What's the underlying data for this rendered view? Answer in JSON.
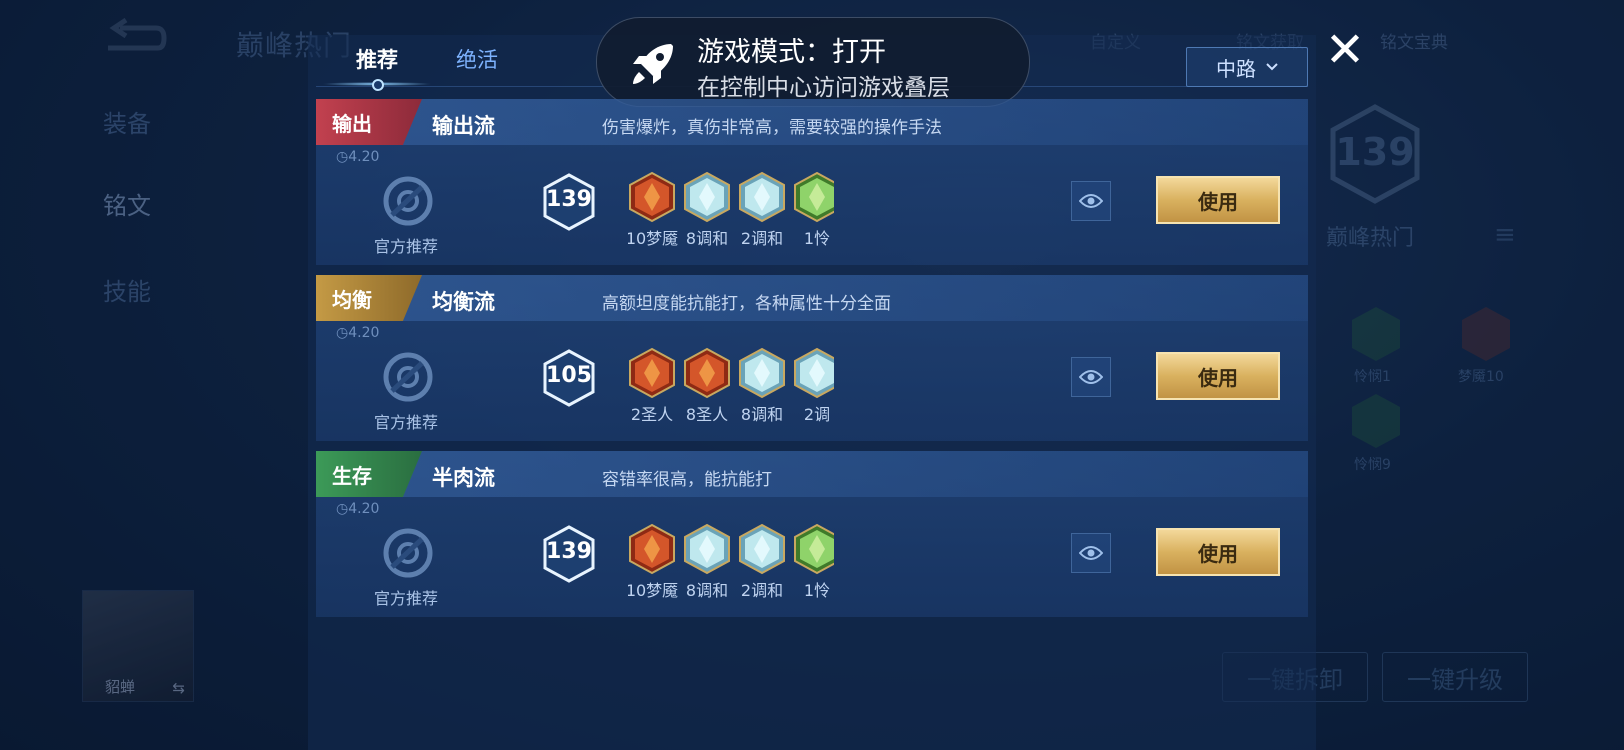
{
  "background": {
    "title": "巅峰热门",
    "sidebar": [
      "装备",
      "铭文",
      "技能"
    ],
    "top_links": [
      "自定义",
      "铭文获取",
      "铭文宝典"
    ],
    "hero_name": "貂蝉",
    "hot_level": "139",
    "hot_label": "巅峰热门",
    "gem_labels": [
      "怜悯1",
      "梦魇10",
      "怜悯9"
    ],
    "buttons": [
      "一键拆卸",
      "一键升级"
    ]
  },
  "banner": {
    "title": "游戏模式：打开",
    "subtitle": "在控制中心访问游戏叠层",
    "icon": "rocket-icon"
  },
  "tabs": [
    {
      "label": "推荐",
      "active": true
    },
    {
      "label": "绝活",
      "active": false
    }
  ],
  "lane_select": {
    "value": "中路"
  },
  "cards": [
    {
      "tag": "输出",
      "tag_color": "#c2414f",
      "name": "输出流",
      "desc": "伤害爆炸，真伤非常高，需要较强的操作手法",
      "date": "4.20",
      "official": "官方推荐",
      "level": "139",
      "gems": [
        {
          "label": "10梦魇",
          "color": "red"
        },
        {
          "label": "8调和",
          "color": "blue"
        },
        {
          "label": "2调和",
          "color": "blue"
        },
        {
          "label": "1怜",
          "color": "green"
        }
      ],
      "use": "使用"
    },
    {
      "tag": "均衡",
      "tag_color": "#c49a45",
      "name": "均衡流",
      "desc": "高额坦度能抗能打，各种属性十分全面",
      "date": "4.20",
      "official": "官方推荐",
      "level": "105",
      "gems": [
        {
          "label": "2圣人",
          "color": "red"
        },
        {
          "label": "8圣人",
          "color": "red"
        },
        {
          "label": "8调和",
          "color": "blue"
        },
        {
          "label": "2调",
          "color": "blue"
        }
      ],
      "use": "使用"
    },
    {
      "tag": "生存",
      "tag_color": "#3c9a58",
      "name": "半肉流",
      "desc": "容错率很高，能抗能打",
      "date": "4.20",
      "official": "官方推荐",
      "level": "139",
      "gems": [
        {
          "label": "10梦魇",
          "color": "red"
        },
        {
          "label": "8调和",
          "color": "blue"
        },
        {
          "label": "2调和",
          "color": "blue"
        },
        {
          "label": "1怜",
          "color": "green"
        }
      ],
      "use": "使用"
    }
  ]
}
